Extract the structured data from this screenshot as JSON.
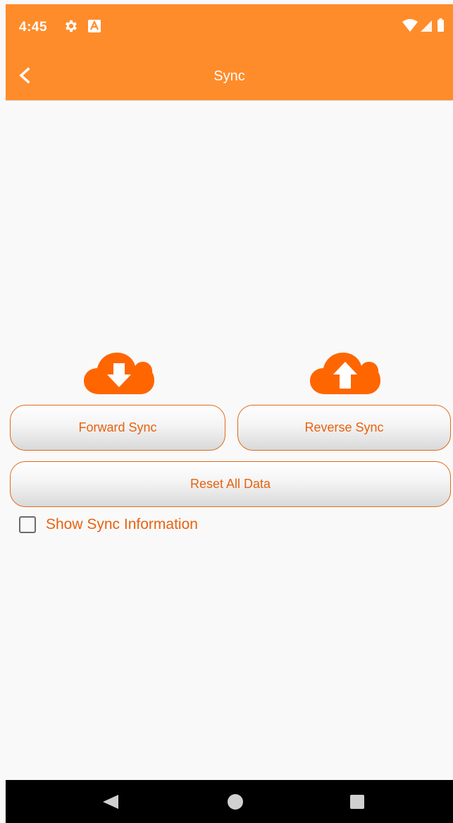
{
  "status_bar": {
    "time": "4:45",
    "icons": [
      "gear-icon",
      "a-notification-icon",
      "wifi-icon",
      "cell-signal-icon",
      "battery-icon"
    ]
  },
  "app_bar": {
    "title": "Sync",
    "back_icon": "chevron-left-icon",
    "background_color": "#ff8c2a"
  },
  "actions": {
    "forward_icon": "cloud-download-icon",
    "reverse_icon": "cloud-upload-icon",
    "forward_label": "Forward Sync",
    "reverse_label": "Reverse Sync",
    "reset_label": "Reset All Data",
    "accent_color": "#ff6600"
  },
  "options": {
    "show_info_label": "Show Sync Information",
    "show_info_checked": false
  },
  "nav_bar": {
    "icons": [
      "nav-back-icon",
      "nav-home-icon",
      "nav-recents-icon"
    ]
  }
}
